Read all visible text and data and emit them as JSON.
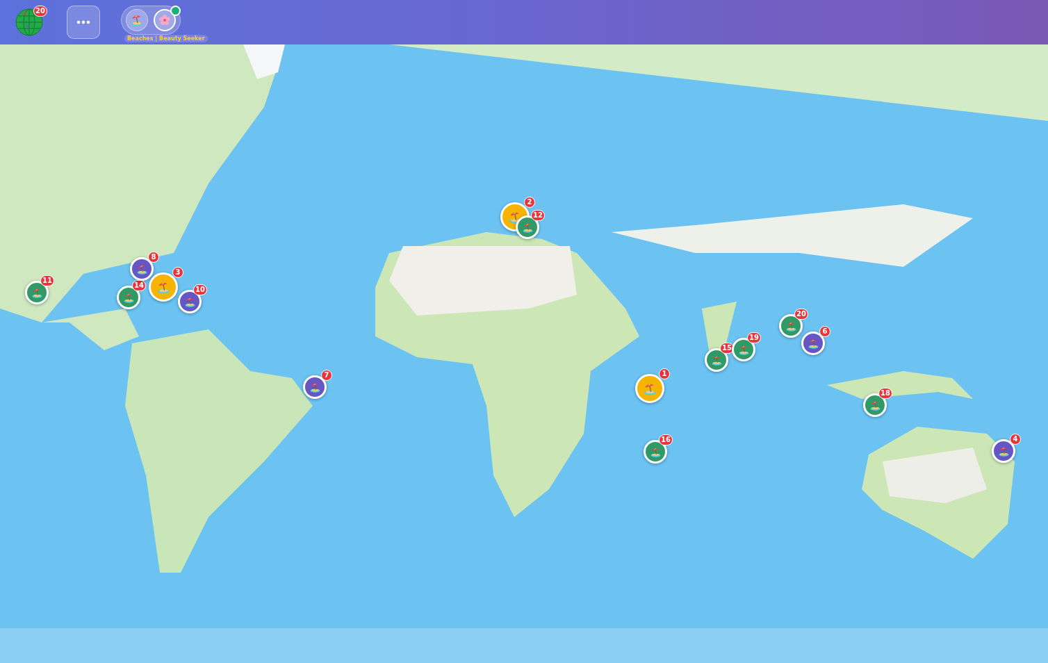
{
  "header": {
    "globe_badge": "20",
    "modes": [
      {
        "kind": "beach",
        "selected": false
      },
      {
        "kind": "flower",
        "selected": true
      }
    ],
    "mode_caption": "Beaches | Beauty Seeker"
  },
  "map": {
    "markers": [
      {
        "count": "11",
        "color": "#2f9a66",
        "kind": "small"
      },
      {
        "count": "14",
        "color": "#2f9a66",
        "kind": "small"
      },
      {
        "count": "8",
        "color": "#6656c4",
        "kind": "small"
      },
      {
        "count": "3",
        "color": "#f6b400",
        "kind": "large"
      },
      {
        "count": "10",
        "color": "#6656c4",
        "kind": "small"
      },
      {
        "count": "7",
        "color": "#6656c4",
        "kind": "small"
      },
      {
        "count": "2",
        "color": "#f6b400",
        "kind": "large"
      },
      {
        "count": "12",
        "color": "#2f9a66",
        "kind": "small"
      },
      {
        "count": "1",
        "color": "#f6b400",
        "kind": "large"
      },
      {
        "count": "16",
        "color": "#2f9a66",
        "kind": "small"
      },
      {
        "count": "15",
        "color": "#2f9a66",
        "kind": "small"
      },
      {
        "count": "19",
        "color": "#2f9a66",
        "kind": "small"
      },
      {
        "count": "20",
        "color": "#2f9a66",
        "kind": "small"
      },
      {
        "count": "6",
        "color": "#6656c4",
        "kind": "small"
      },
      {
        "count": "18",
        "color": "#2f9a66",
        "kind": "small"
      },
      {
        "count": "4",
        "color": "#6656c4",
        "kind": "small"
      }
    ]
  }
}
